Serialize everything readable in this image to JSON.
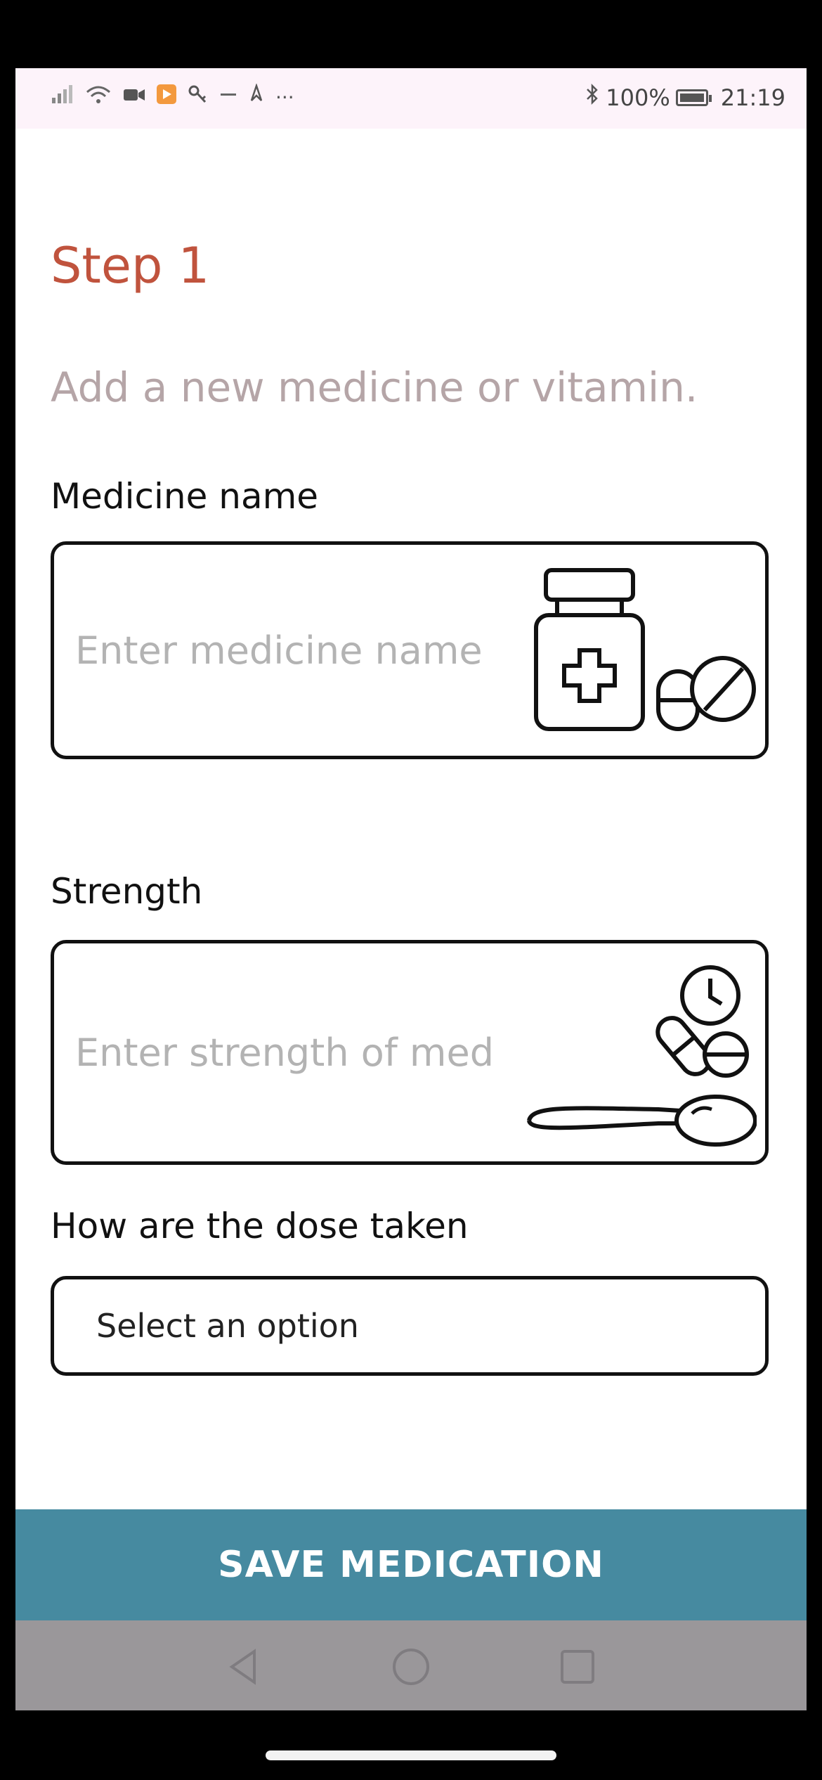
{
  "status_bar": {
    "left_icons": [
      "signal-icon",
      "wifi-icon",
      "video-icon",
      "media-icon",
      "key-icon",
      "dash-icon",
      "flame-icon",
      "more-icon"
    ],
    "more_glyph": "···",
    "battery_percent": "100%",
    "time": "21:19"
  },
  "header": {
    "step": "Step 1",
    "subtitle": "Add a new medicine or vitamin."
  },
  "form": {
    "medicine_name": {
      "label": "Medicine name",
      "placeholder": "Enter medicine name",
      "value": "",
      "illustration": "medicine-bottle-and-pills-icon"
    },
    "strength": {
      "label": "Strength",
      "placeholder": "Enter strength of med",
      "value": "",
      "illustration": "clock-pills-spoon-icon"
    },
    "dose": {
      "label": "How are the dose taken",
      "selected": "Select an option"
    }
  },
  "actions": {
    "save_label": "SAVE MEDICATION"
  },
  "navigation": {
    "buttons": [
      "back-icon",
      "home-icon",
      "recents-icon"
    ]
  },
  "colors": {
    "step_title": "#c0533d",
    "subtitle": "#b5a5a7",
    "save_button": "#468aa0",
    "nav_bar": "#9a979a",
    "status_bar": "#fdf3fa"
  }
}
